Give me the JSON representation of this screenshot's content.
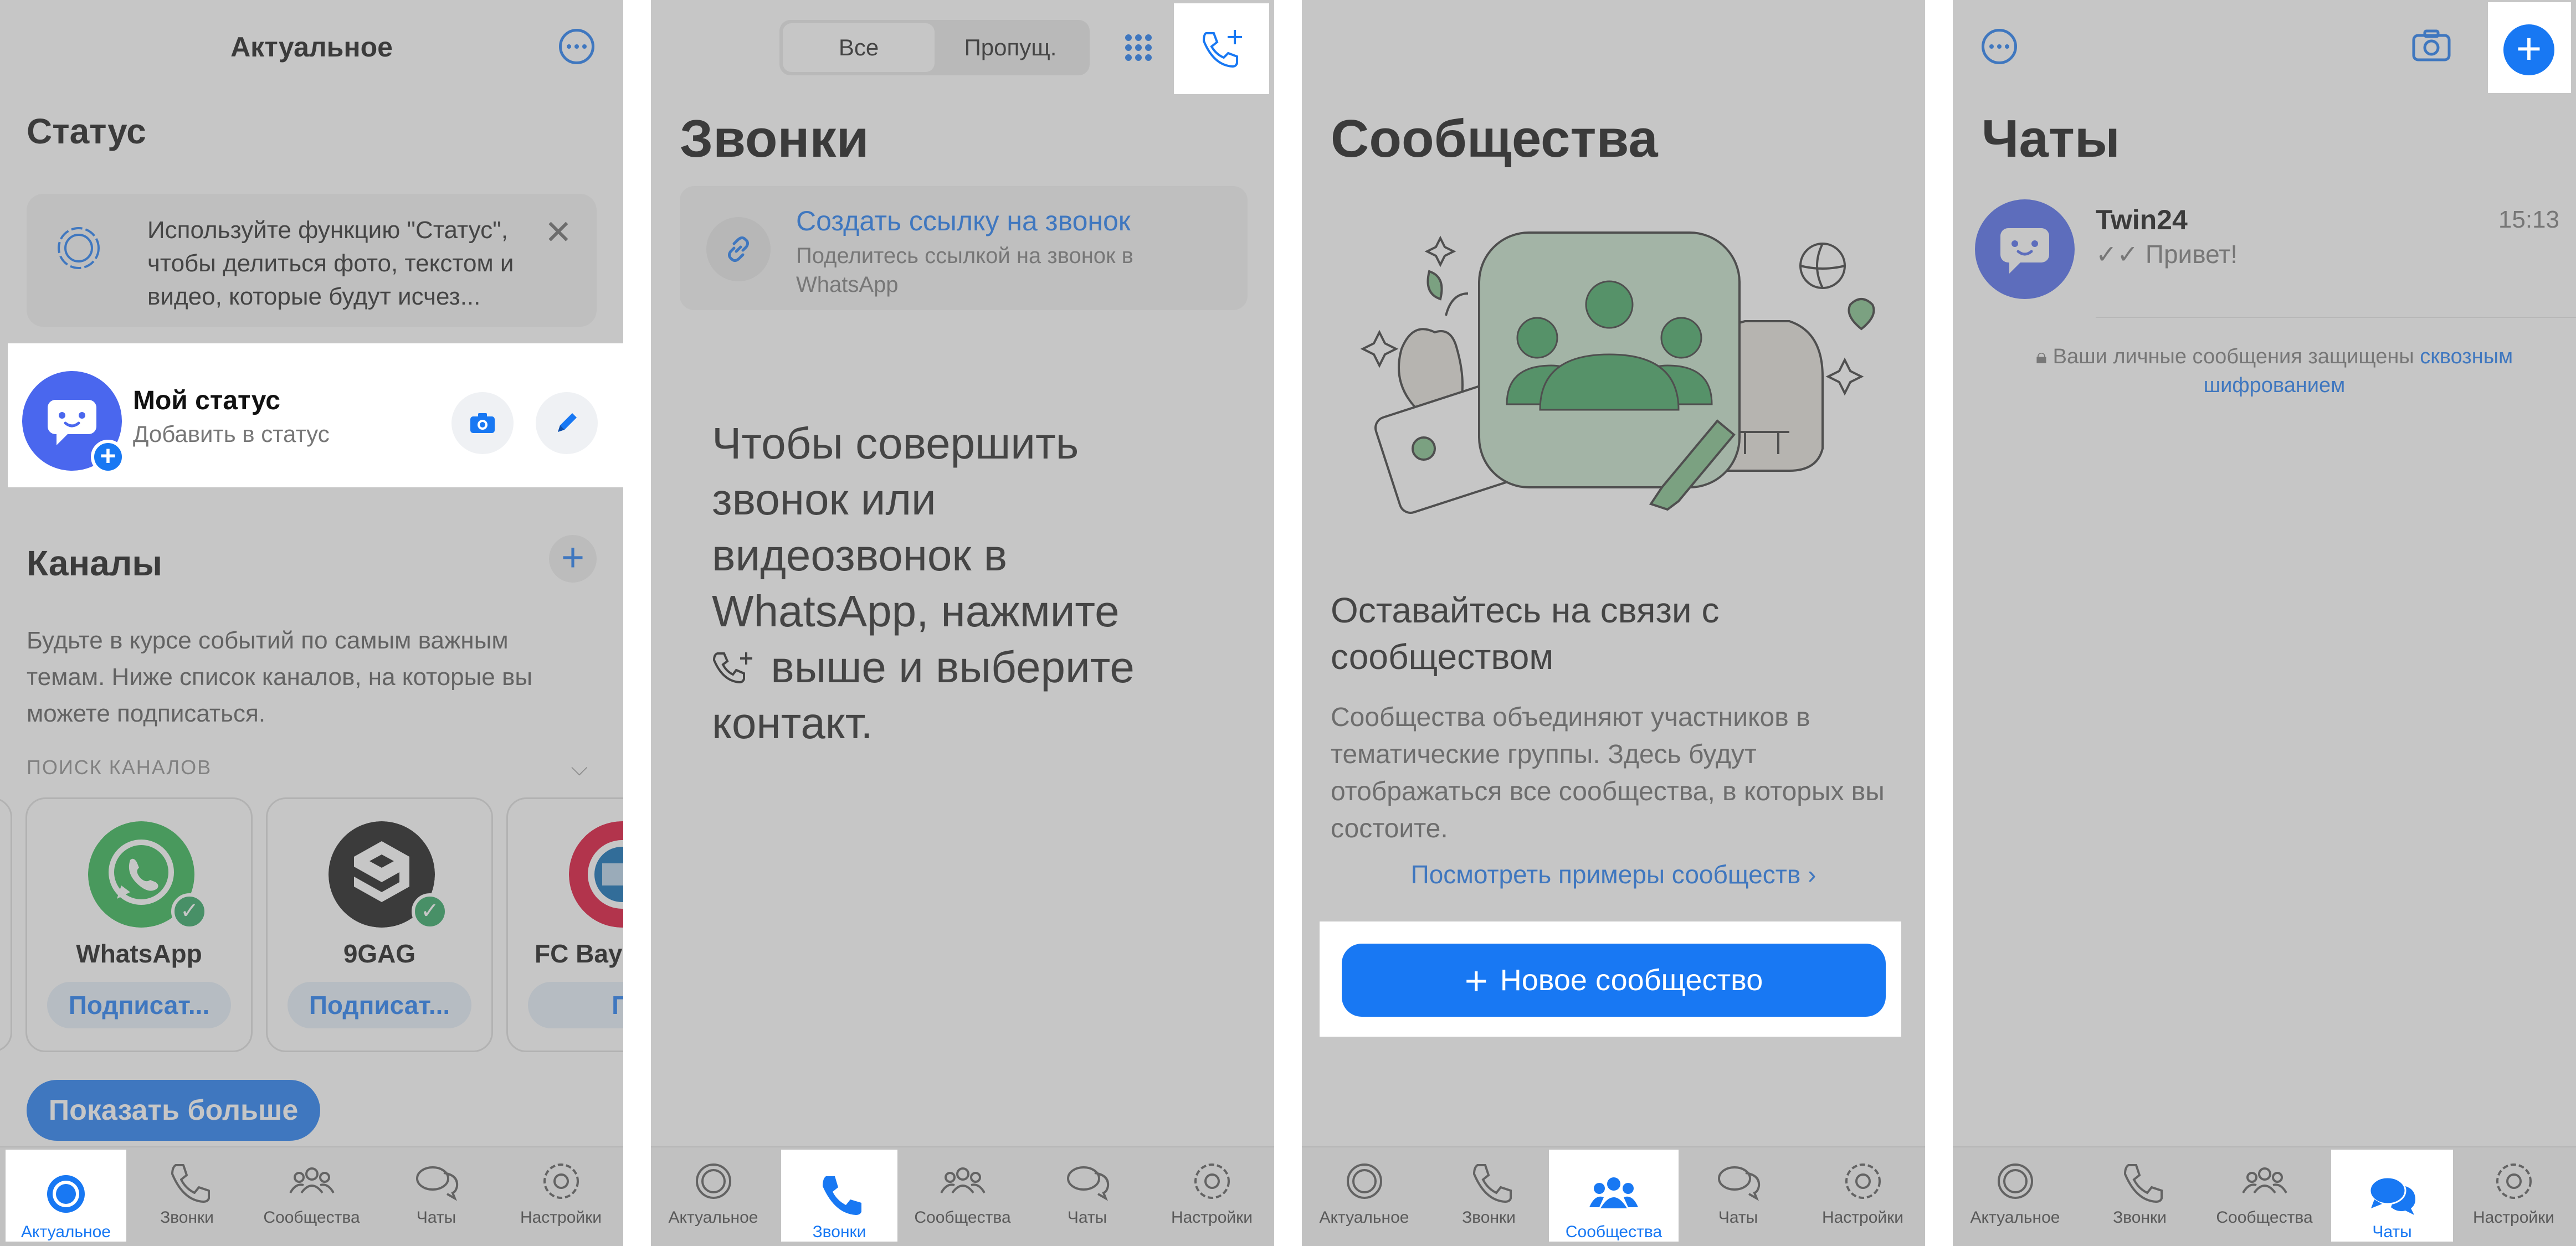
{
  "panel1": {
    "title": "Актуальное",
    "status_heading": "Статус",
    "status_tip": "Используйте функцию \"Статус\", чтобы делиться фото, текстом и видео, которые будут исчез...",
    "my_status": {
      "name": "Мой статус",
      "subtitle": "Добавить в статус"
    },
    "channels_heading": "Каналы",
    "channels_desc": "Будьте в курсе событий по самым важным темам. Ниже список каналов, на которые вы можете подписаться.",
    "search_label": "ПОИСК КАНАЛОВ",
    "channels": [
      {
        "name": "WhatsApp",
        "button": "Подписат..."
      },
      {
        "name": "9GAG",
        "button": "Подписат..."
      },
      {
        "name": "FC Baye",
        "button": "Подпи"
      }
    ],
    "show_more": "Показать больше"
  },
  "panel2": {
    "segments": [
      "Все",
      "Пропущ."
    ],
    "title": "Звонки",
    "link_title": "Создать ссылку на звонок",
    "link_sub": "Поделитесь ссылкой на звонок в WhatsApp",
    "instructions_1": "Чтобы совершить звонок или видеозвонок в WhatsApp, нажмите",
    "instructions_2": "выше и выберите контакт."
  },
  "panel3": {
    "title": "Сообщества",
    "stay": "Оставайтесь на связи с сообществом",
    "desc": "Сообщества объединяют участников в тематические группы. Здесь будут отображаться все сообщества, в которых вы состоите.",
    "examples": "Посмотреть примеры сообществ",
    "new_button": "Новое сообщество"
  },
  "panel4": {
    "title": "Чаты",
    "chat": {
      "name": "Twin24",
      "time": "15:13",
      "message": "Привет!"
    },
    "encryption": "Ваши личные сообщения защищены",
    "encryption_link": "сквозным шифрованием"
  },
  "nav": [
    "Актуальное",
    "Звонки",
    "Сообщества",
    "Чаты",
    "Настройки"
  ],
  "colors": {
    "accent": "#1878f3",
    "avatar": "#4a67ee",
    "community_green": "#3fa65f"
  },
  "icons": {
    "status": "status-icon",
    "calls": "phone-icon",
    "communities": "people-icon",
    "chats": "chat-bubbles-icon",
    "settings": "gear-icon"
  }
}
